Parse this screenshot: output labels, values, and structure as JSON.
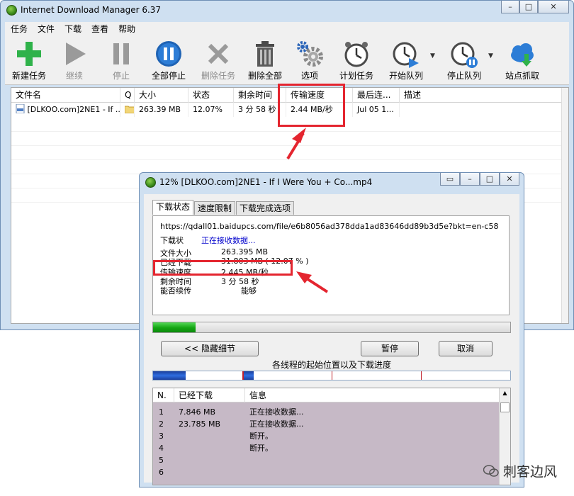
{
  "main_window": {
    "title": "Internet Download Manager 6.37",
    "menu": [
      "任务",
      "文件",
      "下载",
      "查看",
      "帮助"
    ],
    "toolbar": [
      {
        "label": "新建任务",
        "icon": "plus-icon",
        "enabled": true
      },
      {
        "label": "继续",
        "icon": "play-icon",
        "enabled": false
      },
      {
        "label": "停止",
        "icon": "pause-icon",
        "enabled": false
      },
      {
        "label": "全部停止",
        "icon": "stop-all-icon",
        "enabled": true
      },
      {
        "label": "删除任务",
        "icon": "x-icon",
        "enabled": false
      },
      {
        "label": "删除全部",
        "icon": "trash-icon",
        "enabled": true
      },
      {
        "label": "选项",
        "icon": "gear-icon",
        "enabled": true
      },
      {
        "label": "计划任务",
        "icon": "alarm-clock-icon",
        "enabled": true
      },
      {
        "label": "开始队列",
        "icon": "start-queue-icon",
        "enabled": true
      },
      {
        "label": "停止队列",
        "icon": "stop-queue-icon",
        "enabled": true
      },
      {
        "label": "站点抓取",
        "icon": "site-grabber-icon",
        "enabled": true
      }
    ],
    "columns": [
      "文件名",
      "Q",
      "大小",
      "状态",
      "剩余时间",
      "传输速度",
      "最后连...",
      "描述"
    ],
    "rows": [
      {
        "file": "[DLKOO.com]2NE1 - If ...",
        "size": "263.39 MB",
        "status": "12.07%",
        "time_left": "3 分 58 秒",
        "speed": "2.44 MB/秒",
        "last": "Jul 05 1..."
      }
    ]
  },
  "dialog": {
    "title": "12% [DLKOO.com]2NE1 - If I Were You + Co...mp4",
    "tabs": [
      "下载状态",
      "速度限制",
      "下载完成选项"
    ],
    "url": "https://qdall01.baidupcs.com/file/e6b8056ad378dda1ad83646dd89b3d5e?bkt=en-c58",
    "status_label": "下载状",
    "status_value": "正在接收数据...",
    "info": [
      {
        "label": "文件大小",
        "value": "263.395  MB"
      },
      {
        "label": "已经下载",
        "value": "31.803  MB  ( 12.07 % )"
      },
      {
        "label": "传输速度",
        "value": "2.445  MB/秒"
      },
      {
        "label": "剩余时间",
        "value": "3  分  58  秒"
      },
      {
        "label": "能否续传",
        "value": "能够"
      }
    ],
    "progress": 0.12,
    "buttons": {
      "hide_details": "<< 隐藏细节",
      "pause": "暂停",
      "cancel": "取消"
    },
    "threads_label": "各线程的起始位置以及下载进度",
    "conn_columns": [
      "N.",
      "已经下载",
      "信息"
    ],
    "connections": [
      {
        "n": "1",
        "downloaded": "7.846  MB",
        "info": "正在接收数据..."
      },
      {
        "n": "2",
        "downloaded": "23.785  MB",
        "info": "正在接收数据..."
      },
      {
        "n": "3",
        "downloaded": "",
        "info": "断开。"
      },
      {
        "n": "4",
        "downloaded": "",
        "info": "断开。"
      },
      {
        "n": "5",
        "downloaded": "",
        "info": ""
      },
      {
        "n": "6",
        "downloaded": "",
        "info": ""
      }
    ]
  },
  "watermark": "刺客边风",
  "colors": {
    "annotation": "#e4252f",
    "progress": "#13a513",
    "title_bar": "#cfe0f1"
  }
}
